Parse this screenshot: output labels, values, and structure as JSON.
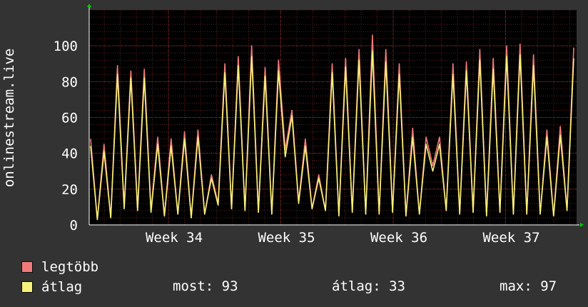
{
  "chart_data": {
    "type": "line",
    "ylabel": "onlinestream.live",
    "ylim": [
      0,
      120
    ],
    "yticks": [
      0,
      20,
      40,
      60,
      80,
      100
    ],
    "x_ticks": [
      "Week 34",
      "Week 35",
      "Week 36",
      "Week 37"
    ],
    "grid": true,
    "background": "#000000",
    "colors": {
      "max": "#f07a7a",
      "avg": "#f6f27a",
      "grid": "#5a2222",
      "axis": "#ffffff",
      "arrow": "#00cc00"
    },
    "series": [
      {
        "name": "legtöbb",
        "values": [
          48,
          3,
          45,
          4,
          89,
          10,
          86,
          9,
          87,
          8,
          49,
          5,
          48,
          6,
          52,
          4,
          53,
          6,
          28,
          12,
          90,
          9,
          94,
          8,
          100,
          7,
          88,
          6,
          92,
          42,
          64,
          13,
          48,
          9,
          28,
          8,
          90,
          5,
          93,
          7,
          98,
          6,
          106,
          6,
          98,
          7,
          90,
          5,
          54,
          6,
          49,
          33,
          49,
          8,
          90,
          6,
          91,
          7,
          98,
          5,
          93,
          7,
          100,
          6,
          101,
          6,
          95,
          6,
          53,
          5,
          55,
          8,
          99
        ]
      },
      {
        "name": "átlag",
        "values": [
          44,
          3,
          41,
          4,
          84,
          9,
          82,
          8,
          82,
          7,
          45,
          5,
          44,
          6,
          48,
          4,
          49,
          6,
          26,
          11,
          85,
          9,
          89,
          8,
          94,
          7,
          83,
          6,
          86,
          38,
          61,
          12,
          44,
          9,
          26,
          8,
          85,
          5,
          88,
          7,
          92,
          6,
          97,
          6,
          91,
          7,
          84,
          5,
          49,
          6,
          45,
          30,
          45,
          8,
          84,
          6,
          86,
          7,
          92,
          5,
          87,
          7,
          94,
          6,
          95,
          6,
          89,
          6,
          49,
          5,
          50,
          8,
          93
        ]
      }
    ]
  },
  "legend": [
    {
      "label": "legtöbb",
      "color": "#f07a7a"
    },
    {
      "label": "átlag",
      "color": "#f6f27a"
    }
  ],
  "stats": {
    "most_label": "most:",
    "most_value": "93",
    "atlag_label": "átlag:",
    "atlag_value": "33",
    "max_label": "max:",
    "max_value": "97"
  }
}
